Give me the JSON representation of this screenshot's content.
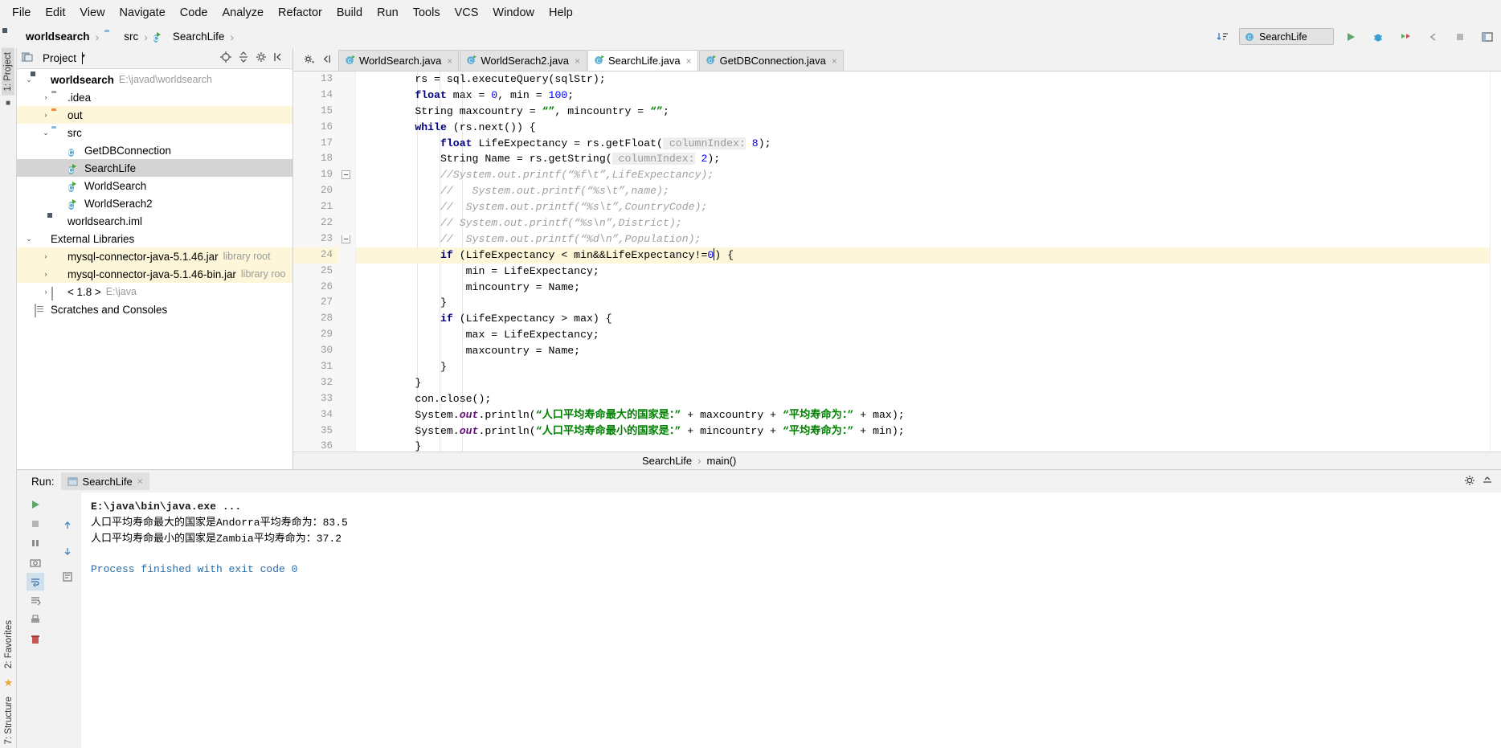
{
  "menu": {
    "items": [
      "File",
      "Edit",
      "View",
      "Navigate",
      "Code",
      "Analyze",
      "Refactor",
      "Build",
      "Run",
      "Tools",
      "VCS",
      "Window",
      "Help"
    ]
  },
  "breadcrumb": {
    "project": "worldsearch",
    "folder": "src",
    "file": "SearchLife",
    "separator": "›"
  },
  "toolbar": {
    "run_config": "SearchLife",
    "sort_icon": "sort-icon",
    "run_icon": "run-icon",
    "debug_icon": "debug-icon",
    "coverage_icon": "coverage-icon",
    "back_icon": "back-icon",
    "stop_icon": "stop-icon",
    "layout_icon": "layout-icon"
  },
  "left_strip": {
    "project_tab": "1: Project",
    "structure_tab": "7: Structure",
    "favorites_tab": "2: Favorites"
  },
  "project_panel": {
    "title": "Project",
    "caret": "▾",
    "icons": [
      "target-icon",
      "collapse-icon",
      "gear-icon",
      "hide-icon"
    ],
    "tree": [
      {
        "indent": 0,
        "arrow": "⌄",
        "icon": "module-icon",
        "label": "worldsearch",
        "bold": true,
        "sub": "E:\\javad\\worldsearch",
        "state": "normal"
      },
      {
        "indent": 1,
        "arrow": "›",
        "icon": "folder-gray",
        "label": ".idea",
        "sub": "",
        "state": "normal"
      },
      {
        "indent": 1,
        "arrow": "›",
        "icon": "folder-orange",
        "label": "out",
        "sub": "",
        "state": "highlight"
      },
      {
        "indent": 1,
        "arrow": "⌄",
        "icon": "folder-blue",
        "label": "src",
        "sub": "",
        "state": "normal"
      },
      {
        "indent": 2,
        "arrow": "",
        "icon": "class-icon",
        "label": "GetDBConnection",
        "sub": "",
        "state": "normal"
      },
      {
        "indent": 2,
        "arrow": "",
        "icon": "class-run-icon",
        "label": "SearchLife",
        "sub": "",
        "state": "selected"
      },
      {
        "indent": 2,
        "arrow": "",
        "icon": "class-run-icon",
        "label": "WorldSearch",
        "sub": "",
        "state": "normal"
      },
      {
        "indent": 2,
        "arrow": "",
        "icon": "class-run-icon",
        "label": "WorldSerach2",
        "sub": "",
        "state": "normal"
      },
      {
        "indent": 1,
        "arrow": "",
        "icon": "iml-icon",
        "label": "worldsearch.iml",
        "sub": "",
        "state": "normal"
      },
      {
        "indent": 0,
        "arrow": "⌄",
        "icon": "libraries-icon",
        "label": "External Libraries",
        "sub": "",
        "state": "normal"
      },
      {
        "indent": 1,
        "arrow": "›",
        "icon": "jar-icon",
        "label": "mysql-connector-java-5.1.46.jar",
        "sub": "library root",
        "state": "highlight"
      },
      {
        "indent": 1,
        "arrow": "›",
        "icon": "jar-icon",
        "label": "mysql-connector-java-5.1.46-bin.jar",
        "sub": "library roo",
        "state": "highlight"
      },
      {
        "indent": 1,
        "arrow": "›",
        "icon": "sdk-icon",
        "label": "< 1.8 >",
        "sub": "E:\\java",
        "state": "normal"
      },
      {
        "indent": 0,
        "arrow": "",
        "icon": "scratches-icon",
        "label": "Scratches and Consoles",
        "sub": "",
        "state": "normal"
      }
    ]
  },
  "editor": {
    "tabs": [
      {
        "label": "WorldSearch.java",
        "active": false
      },
      {
        "label": "WorldSerach2.java",
        "active": false
      },
      {
        "label": "SearchLife.java",
        "active": true
      },
      {
        "label": "GetDBConnection.java",
        "active": false
      }
    ],
    "tab_close": "×",
    "lead_icons": [
      "gear-icon",
      "collapse-all-icon"
    ],
    "first_line_number": 13,
    "lines": [
      {
        "n": 13,
        "indent": 2,
        "highlight": false,
        "tokens": [
          {
            "t": "rs = sql.executeQuery(sqlStr);",
            "c": "plain"
          }
        ]
      },
      {
        "n": 14,
        "indent": 2,
        "highlight": false,
        "tokens": [
          {
            "t": "float",
            "c": "kw"
          },
          {
            "t": " max = ",
            "c": "plain"
          },
          {
            "t": "0",
            "c": "num"
          },
          {
            "t": ", min = ",
            "c": "plain"
          },
          {
            "t": "100",
            "c": "num"
          },
          {
            "t": ";",
            "c": "plain"
          }
        ]
      },
      {
        "n": 15,
        "indent": 2,
        "highlight": false,
        "tokens": [
          {
            "t": "String maxcountry = ",
            "c": "plain"
          },
          {
            "t": "“”",
            "c": "str"
          },
          {
            "t": ", mincountry = ",
            "c": "plain"
          },
          {
            "t": "“”",
            "c": "str"
          },
          {
            "t": ";",
            "c": "plain"
          }
        ]
      },
      {
        "n": 16,
        "indent": 2,
        "highlight": false,
        "tokens": [
          {
            "t": "while",
            "c": "kw"
          },
          {
            "t": " (rs.next()) {",
            "c": "plain"
          }
        ]
      },
      {
        "n": 17,
        "indent": 3,
        "highlight": false,
        "tokens": [
          {
            "t": "float",
            "c": "kw"
          },
          {
            "t": " LifeExpectancy = rs.getFloat(",
            "c": "plain"
          },
          {
            "t": " columnIndex:",
            "c": "hint"
          },
          {
            "t": " ",
            "c": "plain"
          },
          {
            "t": "8",
            "c": "num"
          },
          {
            "t": ");",
            "c": "plain"
          }
        ]
      },
      {
        "n": 18,
        "indent": 3,
        "highlight": false,
        "tokens": [
          {
            "t": "String Name = rs.getString(",
            "c": "plain"
          },
          {
            "t": " columnIndex:",
            "c": "hint"
          },
          {
            "t": " ",
            "c": "plain"
          },
          {
            "t": "2",
            "c": "num"
          },
          {
            "t": ");",
            "c": "plain"
          }
        ]
      },
      {
        "n": 19,
        "indent": 3,
        "highlight": false,
        "fold": true,
        "tokens": [
          {
            "t": "//System.out.printf(“%f\\t”,LifeExpectancy);",
            "c": "cmt"
          }
        ]
      },
      {
        "n": 20,
        "indent": 3,
        "highlight": false,
        "tokens": [
          {
            "t": "//   System.out.printf(“%s\\t”,name);",
            "c": "cmt"
          }
        ]
      },
      {
        "n": 21,
        "indent": 3,
        "highlight": false,
        "tokens": [
          {
            "t": "//  System.out.printf(“%s\\t”,CountryCode);",
            "c": "cmt"
          }
        ]
      },
      {
        "n": 22,
        "indent": 3,
        "highlight": false,
        "tokens": [
          {
            "t": "// System.out.printf(“%s\\n”,District);",
            "c": "cmt"
          }
        ]
      },
      {
        "n": 23,
        "indent": 3,
        "highlight": false,
        "fold2": true,
        "tokens": [
          {
            "t": "//  System.out.printf(“%d\\n”,Population);",
            "c": "cmt"
          }
        ]
      },
      {
        "n": 24,
        "indent": 3,
        "highlight": true,
        "caret": true,
        "tokens": [
          {
            "t": "if",
            "c": "kw"
          },
          {
            "t": " (LifeExpectancy ",
            "c": "plain"
          },
          {
            "t": "<",
            "c": "plain"
          },
          {
            "t": " min&&LifeExpectancy!=",
            "c": "plain"
          },
          {
            "t": "0",
            "c": "num"
          },
          {
            "t": "CARET",
            "c": "caret"
          },
          {
            "t": ") {",
            "c": "plain"
          }
        ]
      },
      {
        "n": 25,
        "indent": 4,
        "highlight": false,
        "tokens": [
          {
            "t": "min = LifeExpectancy;",
            "c": "plain"
          }
        ]
      },
      {
        "n": 26,
        "indent": 4,
        "highlight": false,
        "tokens": [
          {
            "t": "mincountry = Name;",
            "c": "plain"
          }
        ]
      },
      {
        "n": 27,
        "indent": 3,
        "highlight": false,
        "tokens": [
          {
            "t": "}",
            "c": "plain"
          }
        ]
      },
      {
        "n": 28,
        "indent": 3,
        "highlight": false,
        "tokens": [
          {
            "t": "if",
            "c": "kw"
          },
          {
            "t": " (LifeExpectancy ",
            "c": "plain"
          },
          {
            "t": ">",
            "c": "plain"
          },
          {
            "t": " max) {",
            "c": "plain"
          }
        ]
      },
      {
        "n": 29,
        "indent": 4,
        "highlight": false,
        "tokens": [
          {
            "t": "max = LifeExpectancy;",
            "c": "plain"
          }
        ]
      },
      {
        "n": 30,
        "indent": 4,
        "highlight": false,
        "tokens": [
          {
            "t": "maxcountry = Name;",
            "c": "plain"
          }
        ]
      },
      {
        "n": 31,
        "indent": 3,
        "highlight": false,
        "tokens": [
          {
            "t": "}",
            "c": "plain"
          }
        ]
      },
      {
        "n": 32,
        "indent": 2,
        "highlight": false,
        "tokens": [
          {
            "t": "}",
            "c": "plain"
          }
        ]
      },
      {
        "n": 33,
        "indent": 2,
        "highlight": false,
        "tokens": [
          {
            "t": "con.close();",
            "c": "plain"
          }
        ]
      },
      {
        "n": 34,
        "indent": 2,
        "highlight": false,
        "tokens": [
          {
            "t": "System.",
            "c": "plain"
          },
          {
            "t": "out",
            "c": "fld2"
          },
          {
            "t": ".println(",
            "c": "plain"
          },
          {
            "t": "“人口平均寿命最大的国家是：”",
            "c": "str"
          },
          {
            "t": " + maxcountry + ",
            "c": "plain"
          },
          {
            "t": "“平均寿命为：”",
            "c": "str"
          },
          {
            "t": " + max);",
            "c": "plain"
          }
        ]
      },
      {
        "n": 35,
        "indent": 2,
        "highlight": false,
        "tokens": [
          {
            "t": "System.",
            "c": "plain"
          },
          {
            "t": "out",
            "c": "fld2"
          },
          {
            "t": ".println(",
            "c": "plain"
          },
          {
            "t": "“人口平均寿命最小的国家是：”",
            "c": "str"
          },
          {
            "t": " + mincountry + ",
            "c": "plain"
          },
          {
            "t": "“平均寿命为：”",
            "c": "str"
          },
          {
            "t": " + min);",
            "c": "plain"
          }
        ]
      },
      {
        "n": 36,
        "indent": 2,
        "highlight": false,
        "clip": true,
        "tokens": [
          {
            "t": "} ",
            "c": "plain"
          }
        ]
      }
    ]
  },
  "status_breadcrumb": {
    "class": "SearchLife",
    "method": "main()",
    "separator": "›"
  },
  "run_panel": {
    "label": "Run:",
    "tab": "SearchLife",
    "tab_close": "×",
    "settings_icon": "gear-icon",
    "hide_icon": "hide-icon",
    "toolbar_icons": [
      "rerun-icon",
      "stop-icon",
      "pause-icon",
      "trace-icon",
      "camera-icon",
      "print-icon",
      "soft-wrap-icon",
      "scroll-end-icon",
      "trash-icon"
    ],
    "console": [
      {
        "text": "E:\\java\\bin\\java.exe ...",
        "style": "cmd"
      },
      {
        "text": "人口平均寿命最大的国家是Andorra平均寿命为：83.5",
        "style": "plain"
      },
      {
        "text": "人口平均寿命最小的国家是Zambia平均寿命为：37.2",
        "style": "plain"
      },
      {
        "text": "",
        "style": "gap"
      },
      {
        "text": "Process finished with exit code 0",
        "style": "exit"
      }
    ]
  },
  "colors": {
    "keyword": "#000080",
    "string": "#008000",
    "comment": "#a0a0a0",
    "number": "#0000ff",
    "highlight_line": "#fdf6d8",
    "selection": "#d4d4d4",
    "accent": "#5eb0d8"
  }
}
